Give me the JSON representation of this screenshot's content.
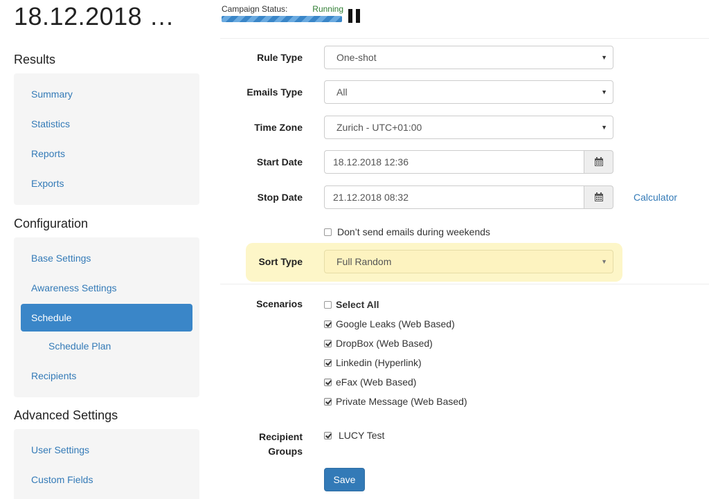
{
  "header": {
    "title": "18.12.2018 …",
    "status_label": "Campaign Status:",
    "status_value": "Running",
    "status_color": "#2e7d32",
    "status_progress": 1.0,
    "pause_icon": "pause-icon"
  },
  "sidebar": {
    "results": {
      "title": "Results",
      "items": [
        "Summary",
        "Statistics",
        "Reports",
        "Exports"
      ]
    },
    "configuration": {
      "title": "Configuration",
      "items": [
        "Base Settings",
        "Awareness Settings",
        "Schedule",
        "Schedule Plan",
        "Recipients"
      ],
      "active": "Schedule"
    },
    "advanced": {
      "title": "Advanced Settings",
      "items": [
        "User Settings",
        "Custom Fields"
      ]
    }
  },
  "form": {
    "rule_type": {
      "label": "Rule Type",
      "value": "One-shot"
    },
    "emails_type": {
      "label": "Emails Type",
      "value": "All"
    },
    "time_zone": {
      "label": "Time Zone",
      "value": "Zurich - UTC+01:00"
    },
    "start_date": {
      "label": "Start Date",
      "value": "18.12.2018 12:36"
    },
    "stop_date": {
      "label": "Stop Date",
      "value": "21.12.2018 08:32"
    },
    "calculator_link": "Calculator",
    "weekends": {
      "label": "Don’t send emails during weekends",
      "checked": false
    },
    "sort_type": {
      "label": "Sort Type",
      "value": "Full Random"
    },
    "scenarios": {
      "label": "Scenarios",
      "select_all": "Select All",
      "items": [
        {
          "label": "Google Leaks (Web Based)",
          "checked": true
        },
        {
          "label": "DropBox (Web Based)",
          "checked": true
        },
        {
          "label": "Linkedin (Hyperlink)",
          "checked": true
        },
        {
          "label": "eFax (Web Based)",
          "checked": true
        },
        {
          "label": "Private Message (Web Based)",
          "checked": true
        }
      ]
    },
    "recipient_groups": {
      "label_line1": "Recipient",
      "label_line2": "Groups",
      "items": [
        {
          "label": "LUCY Test",
          "checked": true
        }
      ]
    },
    "save_label": "Save"
  },
  "colors": {
    "accent": "#337ab7",
    "active_nav": "#3a86c8",
    "highlight": "#fdf6c8"
  }
}
